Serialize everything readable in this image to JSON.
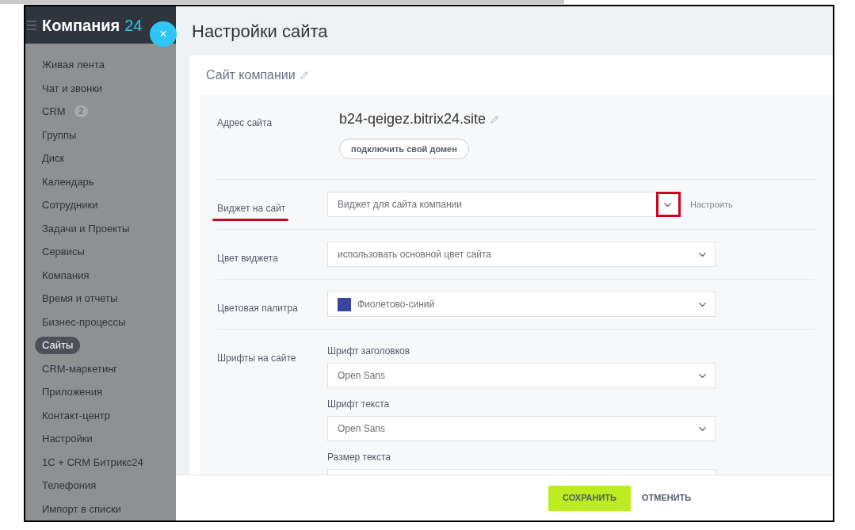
{
  "sidebar": {
    "logo_name": "Компания",
    "logo_number": "24",
    "close": "×",
    "items": [
      {
        "label": "Живая лента",
        "selected": false
      },
      {
        "label": "Чат и звонки",
        "selected": false
      },
      {
        "label": "CRM",
        "badge": "2",
        "selected": false
      },
      {
        "label": "Группы",
        "selected": false
      },
      {
        "label": "Диск",
        "selected": false
      },
      {
        "label": "Календарь",
        "selected": false
      },
      {
        "label": "Сотрудники",
        "selected": false
      },
      {
        "label": "Задачи и Проекты",
        "selected": false
      },
      {
        "label": "Сервисы",
        "selected": false
      },
      {
        "label": "Компания",
        "selected": false
      },
      {
        "label": "Время и отчеты",
        "selected": false
      },
      {
        "label": "Бизнес-процессы",
        "selected": false
      },
      {
        "label": "Сайты",
        "selected": true
      },
      {
        "label": "CRM-маркетинг",
        "selected": false
      },
      {
        "label": "Приложения",
        "selected": false
      },
      {
        "label": "Контакт-центр",
        "selected": false
      },
      {
        "label": "Настройки",
        "selected": false
      },
      {
        "label": "1С + CRM Битрикс24",
        "selected": false
      },
      {
        "label": "Телефония",
        "selected": false
      },
      {
        "label": "Импорт в списки",
        "selected": false
      }
    ]
  },
  "page": {
    "title": "Настройки сайта",
    "card_title": "Сайт компании"
  },
  "rows": [
    {
      "kind": "address",
      "label": "Адрес сайта",
      "value": "b24-qeigez.bitrix24.site",
      "button": "подключить свой домен"
    },
    {
      "kind": "select",
      "label": "Виджет на сайт",
      "value": "Виджет для сайта компании",
      "link": "Настроить",
      "annotated": true
    },
    {
      "kind": "select",
      "label": "Цвет виджета",
      "value": "использовать основной цвет сайта",
      "annotated": false
    },
    {
      "kind": "select",
      "label": "Цветовая палитра",
      "value": "Фиолетово-синий",
      "color": "#3a45a0",
      "annotated": false
    },
    {
      "kind": "fonts",
      "label": "Шрифты на сайте",
      "fields": [
        {
          "label": "Шрифт заголовков",
          "value": "Open Sans"
        },
        {
          "label": "Шрифт текста",
          "value": "Open Sans"
        },
        {
          "label": "Размер текста"
        }
      ]
    }
  ],
  "footer": {
    "save": "СОХРАНИТЬ",
    "cancel": "ОТМЕНИТЬ"
  }
}
